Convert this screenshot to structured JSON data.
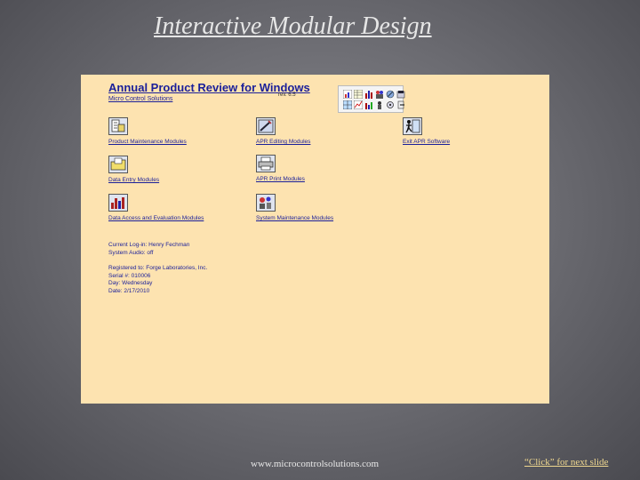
{
  "slide": {
    "title": "Interactive Modular Design",
    "footer_url": "www.microcontrolsolutions.com",
    "footer_click": "“Click” for next slide"
  },
  "app": {
    "title": "Annual Product Review for Windows",
    "version": "rev. 6.5",
    "company": "Micro Control Solutions"
  },
  "toolbar": {
    "icons": [
      "chart-icon",
      "table-icon",
      "bar-icon",
      "people-icon",
      "wrench-icon",
      "folder-icon",
      "grid-icon",
      "graph-icon",
      "bars-icon",
      "person-icon",
      "settings-icon",
      "exit-icon"
    ]
  },
  "modules": {
    "product_maintenance": "Product Maintenance Modules",
    "apr_editing": "APR Editing Modules",
    "exit_apr": "Exit APR Software",
    "data_entry": "Data Entry Modules",
    "apr_print": "APR Print Modules",
    "data_access": "Data Access and Evaluation Modules",
    "system_maintenance": "System Maintenance Modules"
  },
  "session": {
    "current_login": "Current Log-in: Henry Fechman",
    "system_audio": "System Audio: off",
    "registered_to": "Registered to: Forge Laboratories, Inc.",
    "serial": "Serial #: 010006",
    "day": "Day: Wednesday",
    "date": "Date: 2/17/2010"
  },
  "colors": {
    "window_bg": "#fde3b0",
    "link_blue": "#1a1f9a"
  }
}
